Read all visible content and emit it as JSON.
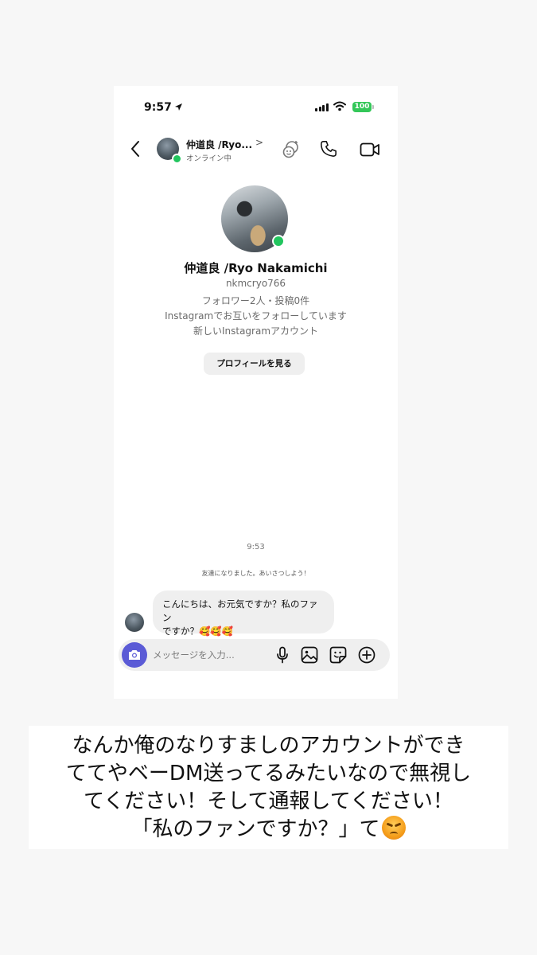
{
  "status_bar": {
    "time": "9:57",
    "battery": "100"
  },
  "header": {
    "name": "仲道良 /Ryo...",
    "chevron": ">",
    "status": "オンライン中"
  },
  "profile": {
    "name": "仲道良 /Ryo Nakamichi",
    "username": "nkmcryo766",
    "stats": "フォロワー2人・投稿0件",
    "mutual": "Instagramでお互いをフォローしています",
    "note": "新しいInstagramアカウント",
    "view_button": "プロフィールを見る"
  },
  "chat": {
    "timestamp": "9:53",
    "system_message": "友達になりました。あいさつしよう！",
    "messages": [
      {
        "line1": "こんにちは、お元気ですか？私のファン",
        "line2": "ですか？🥰🥰🥰"
      }
    ]
  },
  "composer": {
    "placeholder": "メッセージを入力..."
  },
  "caption": {
    "line1": "なんか俺のなりすましのアカウントができ",
    "line2": "ててやベーDM送ってるみたいなので無視し",
    "line3": "てください！そして通報してください！",
    "line4": "「私のファンですか？」て"
  },
  "icons": {
    "status": [
      "location-arrow-icon",
      "signal-icon",
      "wifi-icon",
      "battery-icon"
    ],
    "header": [
      "back-icon",
      "effects-icon",
      "phone-icon",
      "video-icon"
    ],
    "composer": [
      "camera-icon",
      "mic-icon",
      "image-icon",
      "sticker-icon",
      "plus-icon"
    ],
    "caption": "angry-face-emoji"
  },
  "colors": {
    "online": "#22c55e",
    "battery": "#34c759",
    "camera_button": "#5b5bd6",
    "bubble": "#efefef"
  }
}
